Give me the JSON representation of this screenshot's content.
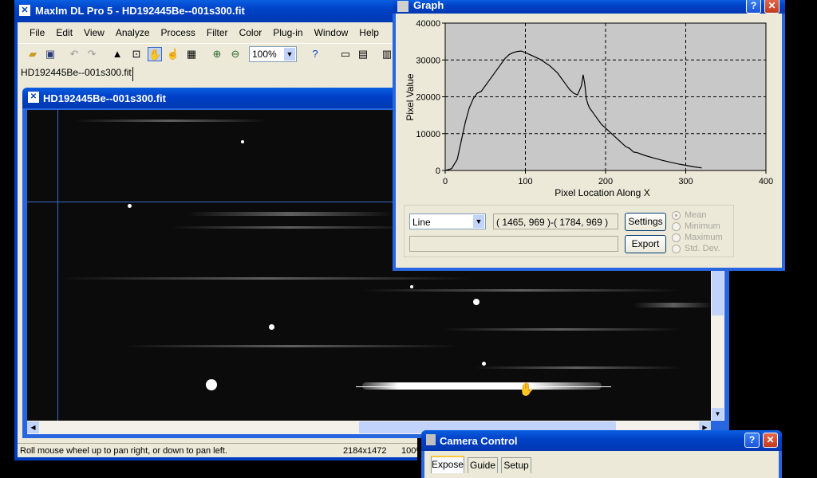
{
  "main_window": {
    "title": "MaxIm DL Pro 5 - HD192445Be--001s300.fit",
    "menu": [
      "File",
      "Edit",
      "View",
      "Analyze",
      "Process",
      "Filter",
      "Color",
      "Plug-in",
      "Window",
      "Help"
    ],
    "zoom": "100%",
    "doc_tab": "HD192445Be--001s300.fit",
    "status_text": "Roll mouse wheel up to pan right, or down to pan left.",
    "status_size": "2184x1472",
    "status_zoom": "100%"
  },
  "image_window": {
    "title": "HD192445Be--001s300.fit"
  },
  "graph_window": {
    "title": "Graph",
    "mode_value": "Line",
    "coords": "( 1465, 969 )-( 1784, 969 )",
    "settings_label": "Settings",
    "export_label": "Export",
    "options": [
      "Mean",
      "Minimum",
      "Maximum",
      "Std. Dev."
    ]
  },
  "camera_window": {
    "title": "Camera Control",
    "tabs": [
      "Expose",
      "Guide",
      "Setup"
    ]
  },
  "chart_data": {
    "type": "line",
    "xlabel": "Pixel Location Along X",
    "ylabel": "Pixel Value",
    "xlim": [
      0,
      400
    ],
    "ylim": [
      0,
      40000
    ],
    "xticks": [
      "0",
      "100",
      "200",
      "300",
      "400"
    ],
    "yticks": [
      "0",
      "10000",
      "20000",
      "30000",
      "40000"
    ],
    "grid": true,
    "x": [
      0,
      8,
      15,
      20,
      25,
      30,
      35,
      40,
      45,
      50,
      55,
      60,
      65,
      70,
      75,
      80,
      85,
      90,
      95,
      100,
      105,
      110,
      115,
      120,
      125,
      130,
      135,
      140,
      145,
      150,
      155,
      160,
      165,
      170,
      172,
      174,
      176,
      178,
      180,
      185,
      190,
      195,
      200,
      205,
      210,
      215,
      220,
      225,
      230,
      235,
      240,
      250,
      260,
      270,
      280,
      290,
      300,
      310,
      320
    ],
    "values": [
      0,
      500,
      3000,
      8000,
      13000,
      17000,
      19500,
      21000,
      21500,
      23000,
      24500,
      26000,
      27500,
      29000,
      30500,
      31500,
      32000,
      32300,
      32400,
      32000,
      31500,
      31000,
      30500,
      30000,
      29200,
      28500,
      27500,
      26500,
      25000,
      23500,
      22000,
      21000,
      20500,
      23000,
      26000,
      23500,
      19500,
      18000,
      17000,
      15500,
      14000,
      12500,
      11500,
      10500,
      9500,
      8500,
      7500,
      6500,
      6000,
      5000,
      4800,
      4000,
      3400,
      2800,
      2300,
      1800,
      1400,
      1000,
      700
    ],
    "line_color": "#000000",
    "plot_background": "#c8c8c8"
  }
}
